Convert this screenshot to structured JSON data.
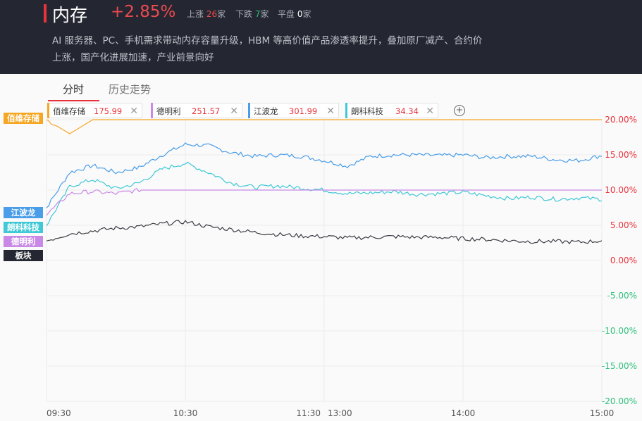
{
  "header": {
    "title": "内存",
    "change": "+2.85%",
    "up_label": "上涨",
    "up_count": "26",
    "up_unit": "家",
    "down_label": "下跌",
    "down_count": "7",
    "down_unit": "家",
    "flat_label": "平盘",
    "flat_count": "0",
    "flat_unit": "家",
    "description": "AI 服务器、PC、手机需求带动内存容量升级，HBM 等高价值产品渗透率提升，叠加原厂减产、合约价上涨，国产化进展加速，产业前景向好"
  },
  "tabs": [
    {
      "label": "分时",
      "active": true
    },
    {
      "label": "历史走势",
      "active": false
    }
  ],
  "stocks": [
    {
      "name": "佰维存储",
      "value": "175.99",
      "color": "#f5a623"
    },
    {
      "name": "德明利",
      "value": "251.57",
      "color": "#c88ae6"
    },
    {
      "name": "江波龙",
      "value": "301.99",
      "color": "#4a9de8"
    },
    {
      "name": "朗科科技",
      "value": "34.34",
      "color": "#3fc8d6"
    }
  ],
  "add_icon": "plus-circle-icon",
  "tags": [
    {
      "label": "佰维存储",
      "color": "#f5a623",
      "text_color": "#ffffff"
    },
    {
      "label": "江波龙",
      "color": "#4a9de8",
      "text_color": "#ffffff"
    },
    {
      "label": "朗科科技",
      "color": "#3fc8d6",
      "text_color": "#ffffff"
    },
    {
      "label": "德明利",
      "color": "#c88ae6",
      "text_color": "#ffffff"
    },
    {
      "label": "板块",
      "color": "#242731",
      "text_color": "#ffffff"
    }
  ],
  "chart_data": {
    "type": "line",
    "x_ticks": [
      "09:30",
      "10:30",
      "11:30",
      "13:00",
      "14:00",
      "15:00"
    ],
    "y_ticks": [
      "20.00%",
      "15.00%",
      "10.00%",
      "5.00%",
      "0.00%",
      "-5.00%",
      "-10.00%",
      "-15.00%",
      "-20.00%"
    ],
    "ylim": [
      -20,
      20
    ],
    "grid": true,
    "up_color": "#e8333b",
    "down_color": "#2ec07a",
    "x_session_index": [
      0,
      10,
      20,
      30,
      40,
      50,
      60,
      70,
      80,
      90,
      100,
      110,
      120,
      130,
      140,
      150,
      160,
      170,
      180,
      190,
      200,
      210,
      220,
      230,
      240
    ],
    "series": [
      {
        "name": "佰维存储",
        "color": "#f5a623",
        "values": [
          20.0,
          18.0,
          20.0,
          20.0,
          20.0,
          20.0,
          20.0,
          20.0,
          20.0,
          20.0,
          20.0,
          20.0,
          20.0,
          20.0,
          20.0,
          20.0,
          20.0,
          20.0,
          20.0,
          20.0,
          20.0,
          20.0,
          20.0,
          20.0,
          20.0
        ]
      },
      {
        "name": "江波龙",
        "color": "#4a9de8",
        "values": [
          7.5,
          12.5,
          13.5,
          12.5,
          13.2,
          15.0,
          16.5,
          16.3,
          15.3,
          14.8,
          15.0,
          14.8,
          14.2,
          13.4,
          14.8,
          15.0,
          15.0,
          14.9,
          15.0,
          14.6,
          14.8,
          14.8,
          14.3,
          14.2,
          14.9
        ]
      },
      {
        "name": "朗科科技",
        "color": "#3fc8d6",
        "values": [
          5.0,
          10.5,
          11.5,
          10.2,
          11.0,
          13.0,
          13.8,
          12.5,
          11.0,
          10.4,
          10.6,
          10.3,
          10.0,
          9.5,
          9.6,
          9.8,
          9.4,
          9.5,
          9.7,
          9.2,
          8.8,
          9.0,
          8.7,
          8.9,
          8.7
        ]
      },
      {
        "name": "德明利",
        "color": "#c88ae6",
        "values": [
          6.5,
          9.5,
          9.8,
          9.5,
          10.0,
          10.0,
          10.0,
          10.0,
          10.0,
          10.0,
          10.0,
          10.0,
          10.0,
          10.0,
          10.0,
          10.0,
          10.0,
          10.0,
          10.0,
          10.0,
          10.0,
          10.0,
          10.0,
          10.0,
          10.0
        ]
      },
      {
        "name": "板块",
        "color": "#3a3c42",
        "values": [
          2.8,
          3.8,
          4.2,
          4.6,
          4.8,
          5.2,
          5.5,
          4.8,
          4.4,
          4.0,
          3.7,
          3.5,
          3.4,
          3.2,
          3.3,
          3.4,
          3.3,
          3.3,
          3.1,
          3.0,
          2.8,
          2.7,
          2.7,
          2.6,
          2.8
        ]
      }
    ]
  }
}
